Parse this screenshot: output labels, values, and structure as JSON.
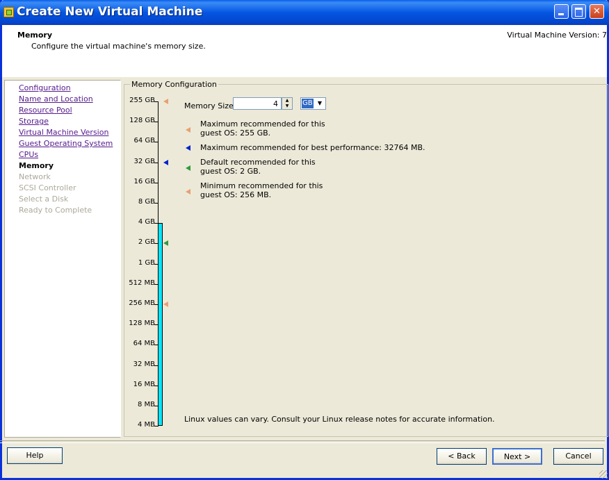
{
  "window": {
    "title": "Create New Virtual Machine"
  },
  "header": {
    "title": "Memory",
    "subtitle": "Configure the virtual machine's memory size.",
    "version": "Virtual Machine Version: 7"
  },
  "nav": {
    "items": [
      {
        "label": "Configuration",
        "state": "visited"
      },
      {
        "label": "Name and Location",
        "state": "visited"
      },
      {
        "label": "Resource Pool",
        "state": "visited"
      },
      {
        "label": "Storage",
        "state": "visited"
      },
      {
        "label": "Virtual Machine Version",
        "state": "visited"
      },
      {
        "label": "Guest Operating System",
        "state": "visited"
      },
      {
        "label": "CPUs",
        "state": "visited"
      },
      {
        "label": "Memory",
        "state": "current"
      },
      {
        "label": "Network",
        "state": "disabled"
      },
      {
        "label": "SCSI Controller",
        "state": "disabled"
      },
      {
        "label": "Select a Disk",
        "state": "disabled"
      },
      {
        "label": "Ready to Complete",
        "state": "disabled"
      }
    ]
  },
  "memory": {
    "group_label": "Memory Configuration",
    "size_label": "Memory Size:",
    "size_value": "4",
    "unit": "GB",
    "scale": [
      "255 GB",
      "128 GB",
      "64 GB",
      "32 GB",
      "16 GB",
      "8 GB",
      "4 GB",
      "2 GB",
      "1 GB",
      "512 MB",
      "256 MB",
      "128 MB",
      "64 MB",
      "32 MB",
      "16 MB",
      "8 MB",
      "4 MB"
    ],
    "filled_to_index": 6,
    "markers": [
      {
        "name": "max-recommended",
        "scale_index": 0,
        "color": "#e8a070"
      },
      {
        "name": "max-best-performance",
        "scale_index": 3,
        "color": "#0022cc"
      },
      {
        "name": "default-recommended",
        "scale_index": 7,
        "color": "#2e9a3a"
      },
      {
        "name": "min-recommended",
        "scale_index": 10,
        "color": "#e8a070"
      }
    ],
    "legend": [
      {
        "line1": "Maximum recommended for this",
        "line2": "guest OS: 255 GB.",
        "color": "#e8a070"
      },
      {
        "line1": "Maximum recommended for best performance: 32764 MB.",
        "line2": "",
        "color": "#0022cc"
      },
      {
        "line1": "Default recommended for this",
        "line2": "guest OS: 2 GB.",
        "color": "#2e9a3a"
      },
      {
        "line1": "Minimum recommended for this",
        "line2": "guest OS: 256 MB.",
        "color": "#e8a070"
      }
    ],
    "footnote": "Linux values can vary. Consult your Linux release notes for accurate information.",
    "bar_color": "#00e7ff"
  },
  "buttons": {
    "help": "Help",
    "back": "< Back",
    "next": "Next >",
    "cancel": "Cancel"
  }
}
